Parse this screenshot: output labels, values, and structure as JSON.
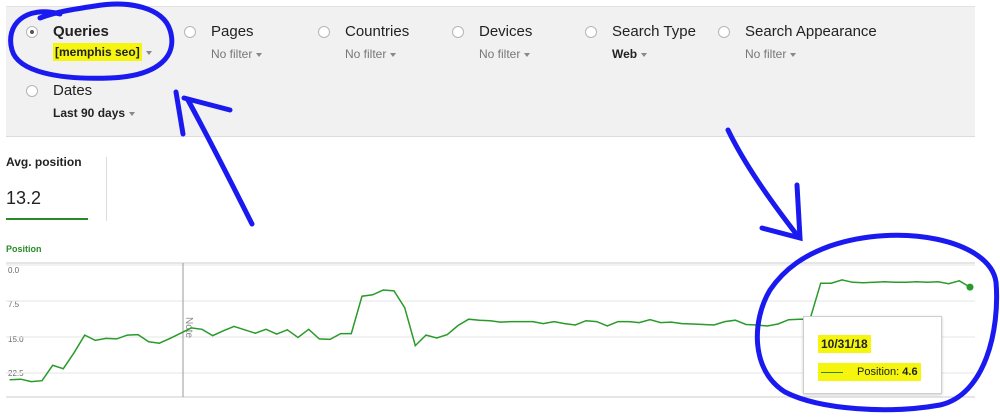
{
  "filters": {
    "queries": {
      "label": "Queries",
      "value": "[memphis seo]"
    },
    "pages": {
      "label": "Pages",
      "value": "No filter"
    },
    "countries": {
      "label": "Countries",
      "value": "No filter"
    },
    "devices": {
      "label": "Devices",
      "value": "No filter"
    },
    "search_type": {
      "label": "Search Type",
      "value": "Web"
    },
    "search_appearance": {
      "label": "Search Appearance",
      "value": "No filter"
    },
    "dates": {
      "label": "Dates",
      "value": "Last 90 days"
    }
  },
  "metric": {
    "label": "Avg. position",
    "value": "13.2"
  },
  "chart_data": {
    "type": "line",
    "series": [
      {
        "name": "Position",
        "values": [
          23.9,
          23.8,
          24.3,
          24.1,
          20.9,
          21.6,
          18.3,
          14.6,
          15.7,
          15.3,
          15.4,
          14.6,
          14.5,
          16.0,
          16.3,
          15.3,
          14.2,
          13.1,
          13.4,
          14.7,
          13.7,
          12.8,
          13.5,
          14.2,
          13.4,
          14.4,
          13.5,
          15.1,
          13.4,
          15.4,
          15.5,
          14.3,
          14.3,
          6.5,
          6.2,
          5.2,
          5.4,
          8.9,
          16.8,
          14.6,
          15.2,
          14.5,
          12.6,
          11.3,
          11.5,
          11.6,
          11.9,
          11.8,
          11.8,
          11.8,
          12.2,
          11.8,
          12.2,
          12.5,
          11.6,
          11.8,
          12.7,
          11.8,
          11.8,
          12.0,
          11.4,
          12.0,
          11.9,
          12.2,
          12.3,
          12.4,
          12.5,
          11.8,
          11.5,
          12.4,
          12.5,
          12.7,
          12.3,
          11.4,
          11.3,
          11.3,
          3.8,
          3.8,
          3.1,
          3.6,
          3.7,
          3.6,
          3.5,
          3.6,
          3.6,
          3.5,
          3.6,
          3.5,
          3.9,
          3.3,
          4.6
        ]
      }
    ],
    "ylim": [
      0,
      27.5
    ],
    "yticks": [
      "0.0",
      "7.5",
      "15.0",
      "22.5"
    ],
    "annotation": "Note",
    "tooltip": {
      "date": "10/31/18",
      "label": "Position:",
      "value": "4.6"
    }
  }
}
